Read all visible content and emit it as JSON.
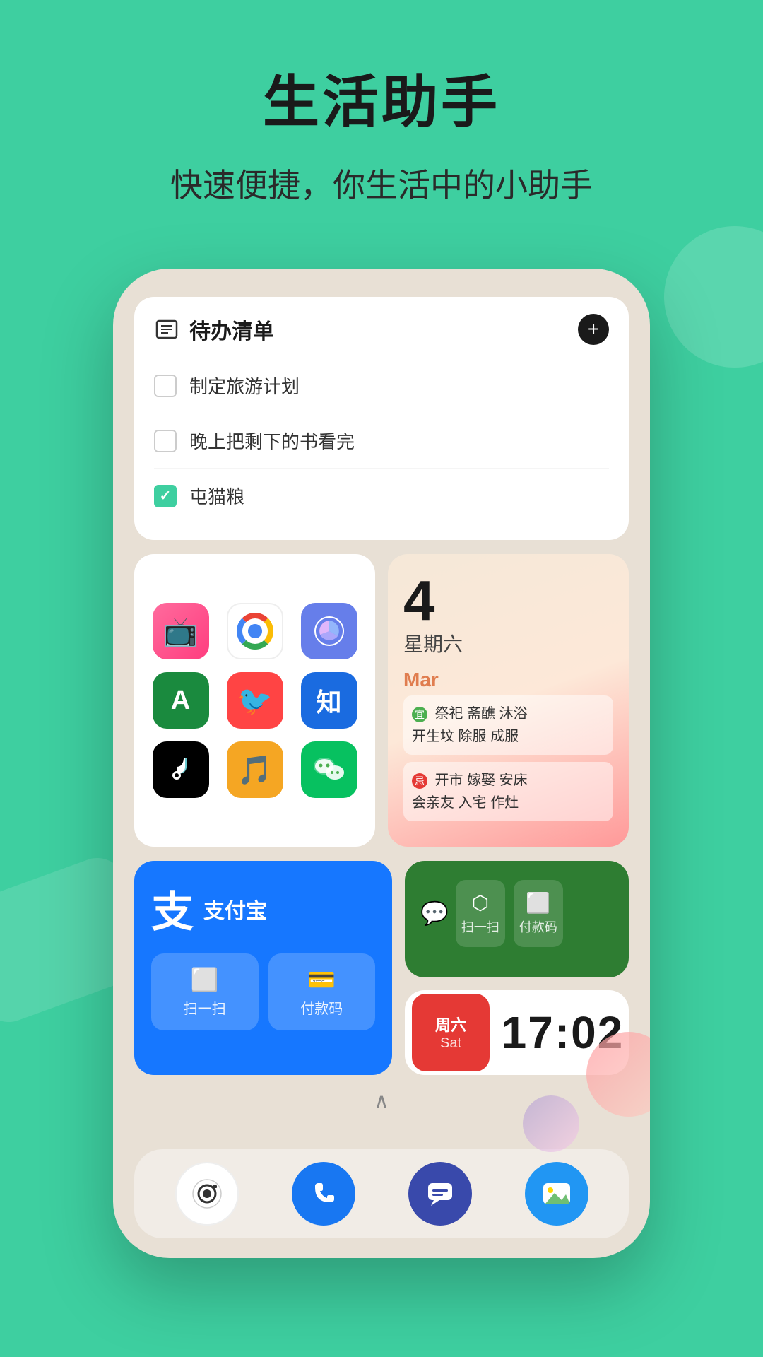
{
  "header": {
    "title": "生活助手",
    "subtitle": "快速便捷，你生活中的小助手"
  },
  "todo_widget": {
    "title": "待办清单",
    "add_button_label": "+",
    "items": [
      {
        "text": "制定旅游计划",
        "checked": false
      },
      {
        "text": "晚上把剩下的书看完",
        "checked": false
      },
      {
        "text": "屯猫粮",
        "checked": true
      }
    ]
  },
  "app_grid": {
    "apps": [
      {
        "name": "media-app",
        "label": "媒体",
        "color": "pink",
        "emoji": "📺"
      },
      {
        "name": "chrome-app",
        "label": "Chrome",
        "color": "chrome",
        "emoji": "🌐"
      },
      {
        "name": "analytics-app",
        "label": "分析",
        "color": "purple",
        "emoji": "📊"
      },
      {
        "name": "ca-app",
        "label": "CA",
        "color": "green-dark",
        "emoji": "A"
      },
      {
        "name": "weibo-app",
        "label": "微博",
        "color": "weibo",
        "emoji": "🐦"
      },
      {
        "name": "zhihu-app",
        "label": "知乎",
        "color": "blue-icon",
        "emoji": "知"
      },
      {
        "name": "tiktok-app",
        "label": "抖音",
        "color": "black",
        "emoji": "♪"
      },
      {
        "name": "music-app",
        "label": "音乐",
        "color": "yellow",
        "emoji": "🎵"
      },
      {
        "name": "wechat-app",
        "label": "微信",
        "color": "wechat-green",
        "emoji": "💬"
      }
    ]
  },
  "calendar_widget": {
    "date": "4",
    "weekday": "星期六",
    "month": "Mar",
    "good_items": "祭祀  斋醮  沐浴\n开生坟  除服  成服",
    "bad_items": "开市  嫁娶  安床\n会亲友  入宅  作灶",
    "good_label": "宜",
    "bad_label": "忌"
  },
  "alipay_widget": {
    "logo": "支",
    "label": "支付宝",
    "scan_label": "扫一扫",
    "pay_label": "付款码"
  },
  "wechat_pay_widget": {
    "scan_label": "扫一扫",
    "pay_label": "付款码"
  },
  "clock_widget": {
    "badge_day": "周六",
    "badge_weekday": "Sat",
    "time": "17:02"
  },
  "dock": {
    "camera_label": "相机",
    "phone_label": "电话",
    "messages_label": "消息",
    "gallery_label": "相册"
  }
}
